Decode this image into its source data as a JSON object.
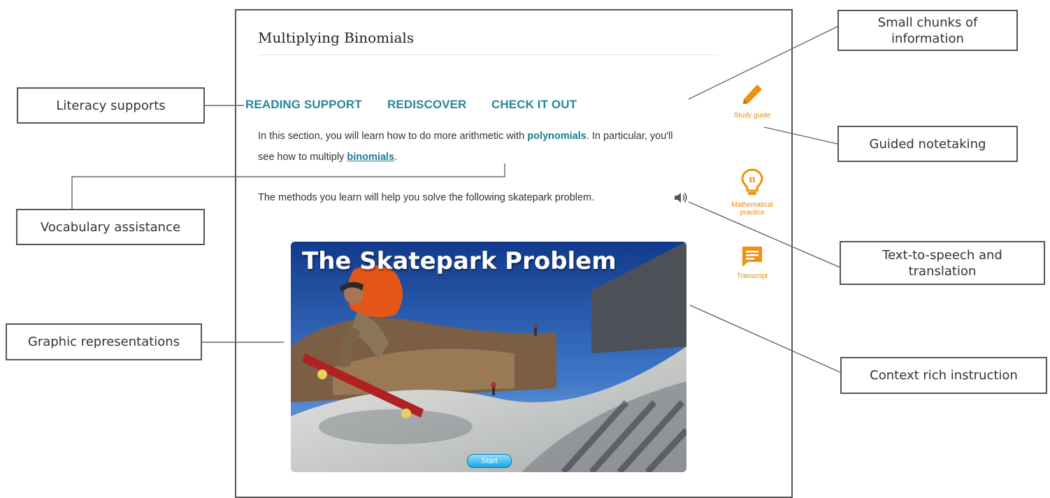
{
  "lesson": {
    "title": "Multiplying Binomials",
    "tabs": [
      "READING SUPPORT",
      "REDISCOVER",
      "CHECK IT OUT"
    ],
    "paragraph1": {
      "before": "In this section, you will learn how to do more arithmetic with ",
      "link1": "polynomials",
      "middle": ". In particular, you'll see how to multiply ",
      "link2": "binomials",
      "end": "."
    },
    "paragraph2": "The methods you learn will help you solve the following skatepark problem."
  },
  "tools": [
    {
      "label": "Study guide",
      "icon": "pencil-icon"
    },
    {
      "label": "Mathematical practice",
      "icon": "lightbulb-pi-icon"
    },
    {
      "label": "Transcript",
      "icon": "transcript-icon"
    }
  ],
  "video": {
    "title": "The Skatepark Problem",
    "start_label": "Start"
  },
  "annotations": {
    "literacy": "Literacy supports",
    "vocabulary": "Vocabulary assistance",
    "graphic": "Graphic representations",
    "chunks": "Small chunks of information",
    "notetaking": "Guided notetaking",
    "tts": "Text-to-speech and translation",
    "context": "Context rich instruction"
  },
  "colors": {
    "accent_teal": "#27879a",
    "tool_orange": "#e8890c",
    "border": "#555555"
  }
}
